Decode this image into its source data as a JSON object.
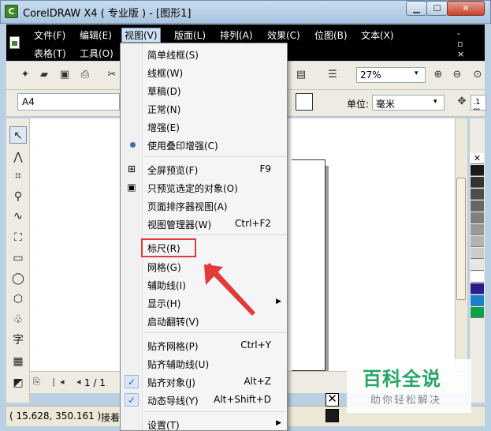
{
  "window": {
    "title": "CorelDRAW X4 ( 专业版 ) - [图形1]",
    "icon_text": "C",
    "min": "▁",
    "max": "☐",
    "close": "✕",
    "doc_controls": "- ▫ ×"
  },
  "menubar": {
    "row1": [
      "文件(F)",
      "编辑(E)",
      "视图(V)",
      "版面(L)",
      "排列(A)",
      "效果(C)",
      "位图(B)",
      "文本(X)"
    ],
    "row2": [
      "表格(T)",
      "工具(O)"
    ]
  },
  "toolbar": {
    "zoom_value": "27%",
    "zoom_arrow": "▾"
  },
  "propbar": {
    "paper": "A4",
    "unit_label": "单位:",
    "unit_value": "毫米",
    "unit_arrow": "▾",
    "nudge": ".1 m"
  },
  "pager": {
    "controls": "⎘ |◂ ◂",
    "counter": "1 / 1"
  },
  "status": {
    "coords": "( 15.628, 350.161 )",
    "tip": "接着"
  },
  "watermark": {
    "title": "百科全说",
    "subtitle": "助你轻松解决"
  },
  "view_menu": {
    "items": [
      {
        "label": "简单线框(S)",
        "shortcut": "",
        "icon": ""
      },
      {
        "label": "线框(W)",
        "shortcut": "",
        "icon": ""
      },
      {
        "label": "草稿(D)",
        "shortcut": "",
        "icon": ""
      },
      {
        "label": "正常(N)",
        "shortcut": "",
        "icon": ""
      },
      {
        "label": "增强(E)",
        "shortcut": "",
        "icon": ""
      },
      {
        "label": "使用叠印增强(C)",
        "shortcut": "",
        "icon": "radio"
      },
      {
        "label": "全屏预览(F)",
        "shortcut": "F9",
        "icon": "fullscreen-icon"
      },
      {
        "label": "只预览选定的对象(O)",
        "shortcut": "",
        "icon": "preview-selected-icon"
      },
      {
        "label": "页面排序器视图(A)",
        "shortcut": "",
        "icon": ""
      },
      {
        "label": "视图管理器(W)",
        "shortcut": "Ctrl+F2",
        "icon": ""
      },
      {
        "label": "标尺(R)",
        "shortcut": "",
        "icon": ""
      },
      {
        "label": "网格(G)",
        "shortcut": "",
        "icon": ""
      },
      {
        "label": "辅助线(I)",
        "shortcut": "",
        "icon": ""
      },
      {
        "label": "显示(H)",
        "shortcut": "",
        "icon": "",
        "submenu": true
      },
      {
        "label": "启动翻转(V)",
        "shortcut": "",
        "icon": ""
      },
      {
        "label": "贴齐网格(P)",
        "shortcut": "Ctrl+Y",
        "icon": ""
      },
      {
        "label": "贴齐辅助线(U)",
        "shortcut": "",
        "icon": ""
      },
      {
        "label": "贴齐对象(J)",
        "shortcut": "Alt+Z",
        "icon": "check"
      },
      {
        "label": "动态导线(Y)",
        "shortcut": "Alt+Shift+D",
        "icon": "check"
      },
      {
        "label": "设置(T)",
        "shortcut": "",
        "icon": "",
        "submenu": true
      }
    ]
  },
  "palette": [
    "#ffffff",
    "#1a1a1a",
    "#333333",
    "#4d4d4d",
    "#666666",
    "#7f7f7f",
    "#999999",
    "#b3b3b3",
    "#cccccc",
    "#e6e6e6",
    "#ffffff",
    "#2b1a8c",
    "#1b7fd0",
    "#0aa14a"
  ]
}
